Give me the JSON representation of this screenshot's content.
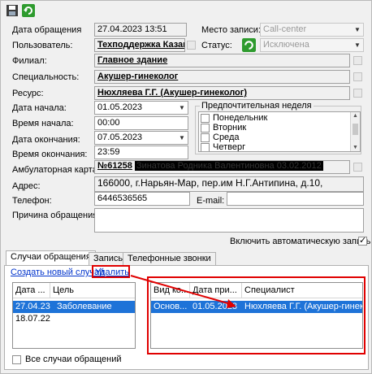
{
  "form": {
    "date_label": "Дата обращения",
    "date_value": "27.04.2023 13:51",
    "place_label": "Место записи:",
    "place_value": "Call-center",
    "user_label": "Пользователь:",
    "user_value": "Техподдержка Казань",
    "status_label": "Статус:",
    "status_value": "Исключена",
    "branch_label": "Филиал:",
    "branch_value": "Главное здание",
    "specialty_label": "Специальность:",
    "specialty_value": "Акушер-гинеколог",
    "resource_label": "Ресурс:",
    "resource_value": "Нюхляева Г.Г. (Акушер-гинеколог)",
    "start_date_label": "Дата начала:",
    "start_date_value": "01.05.2023",
    "start_time_label": "Время начала:",
    "start_time_value": "00:00",
    "end_date_label": "Дата окончания:",
    "end_date_value": "07.05.2023",
    "end_time_label": "Время окончания:",
    "end_time_value": "23:59",
    "week_label": "Предпочтительная неделя",
    "weekdays": [
      "Понедельник",
      "Вторник",
      "Среда",
      "Четверг"
    ],
    "card_label": "Амбулаторная карта:",
    "card_number": "№61258",
    "card_name": "Зинатова Родника Валентиновна 03.02.2012",
    "address_label": "Адрес:",
    "address_value": "166000, г.Нарьян-Мар, пер.им Н.Г.Антипина, д.10,",
    "phone_label": "Телефон:",
    "phone_value": "6446536565",
    "email_label": "E-mail:",
    "email_value": "",
    "reason_label": "Причина обращения:",
    "auto_record_label": "Включить автоматическую запись"
  },
  "tabs": [
    "Случаи обращения",
    "Запись",
    "Телефонные звонки"
  ],
  "links": {
    "create": "Создать новый случай",
    "delete": "Удалить"
  },
  "left_grid": {
    "headers": [
      "Дата ...",
      "Цель"
    ],
    "rows": [
      {
        "date": "27.04.23",
        "goal": "Заболевание",
        "selected": true
      },
      {
        "date": "18.07.22",
        "goal": "",
        "selected": false
      }
    ]
  },
  "right_grid": {
    "headers": [
      "Вид ко...",
      "Дата при...",
      "Специалист"
    ],
    "rows": [
      {
        "type": "Основ...",
        "date": "01.05.2023",
        "specialist": "Нюхляева Г.Г. (Акушер-гинек..."
      }
    ]
  },
  "all_cases_label": "Все случаи обращений",
  "colors": {
    "selection": "#1e73d8",
    "highlight": "#e00000",
    "link": "#0033cc"
  },
  "icons": [
    "save-icon",
    "refresh-icon"
  ]
}
